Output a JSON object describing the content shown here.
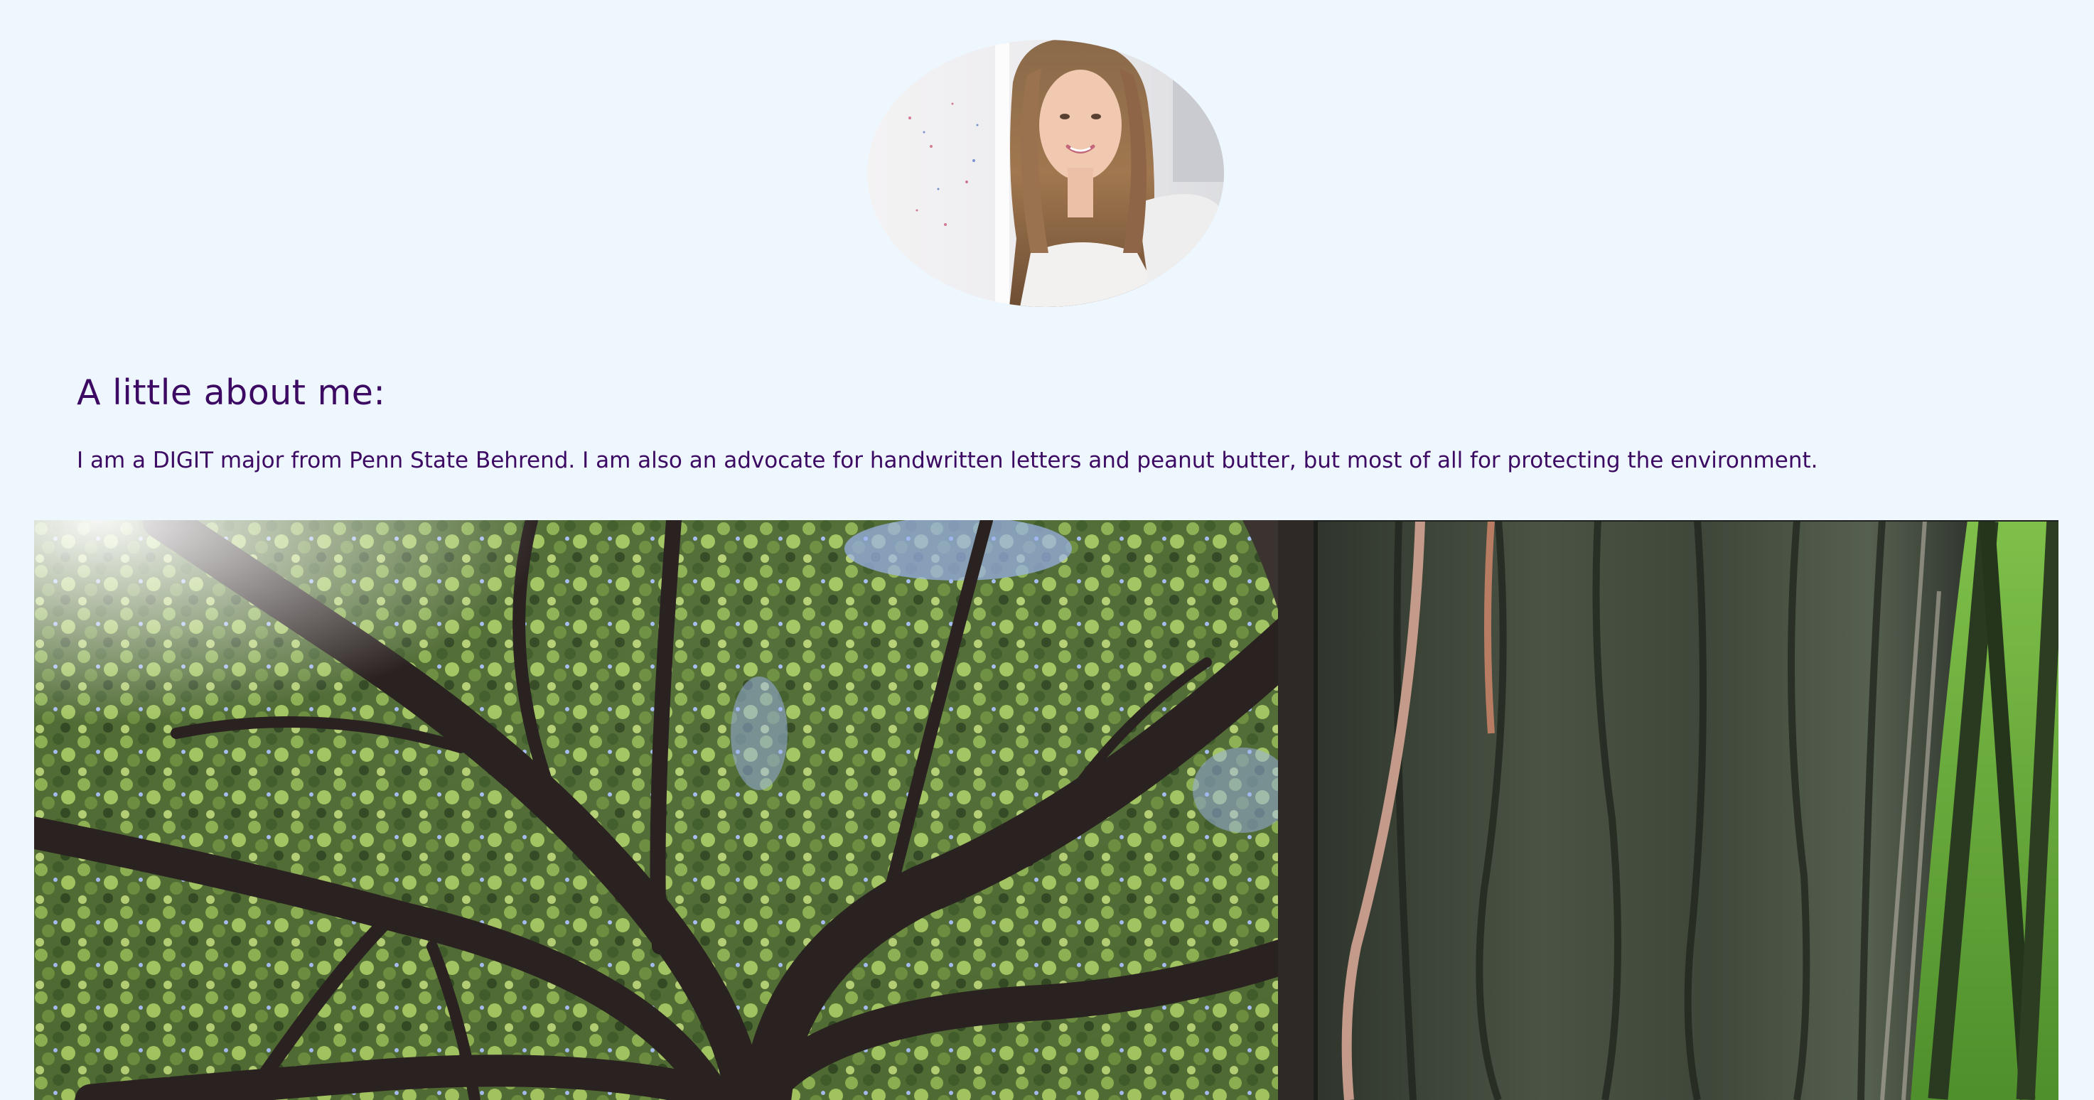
{
  "profile": {
    "avatar_icon": "profile-photo",
    "avatar_alt": "Profile photo"
  },
  "about": {
    "heading": "A little about me:",
    "body": "I am a DIGIT major from Penn State Behrend. I am also an advocate for handwritten letters and peanut butter, but most of all for protecting the environment."
  },
  "gallery": {
    "photos": [
      {
        "icon": "tree-canopy-photo",
        "alt": "Looking up into a tree canopy"
      },
      {
        "icon": "tree-trunk-photo",
        "alt": "Close-up of a tree trunk"
      }
    ]
  },
  "colors": {
    "background": "#eef6fe",
    "text": "#3c0a63"
  }
}
